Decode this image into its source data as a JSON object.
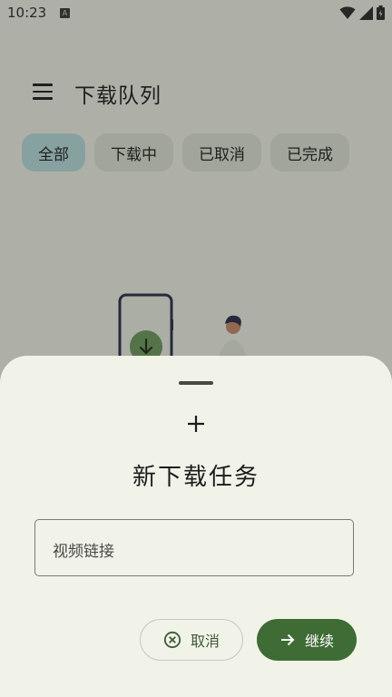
{
  "status_bar": {
    "time": "10:23",
    "notification_icon": "a-icon",
    "icons": [
      "wifi-icon",
      "signal-icon",
      "battery-icon"
    ]
  },
  "app_bar": {
    "menu_icon": "menu-icon",
    "title": "下载队列"
  },
  "filters": {
    "items": [
      {
        "label": "全部",
        "selected": true
      },
      {
        "label": "下载中",
        "selected": false
      },
      {
        "label": "已取消",
        "selected": false
      },
      {
        "label": "已完成",
        "selected": false
      }
    ]
  },
  "sheet": {
    "icon": "plus-icon",
    "title": "新下载任务",
    "url_field": {
      "placeholder": "视频链接",
      "value": ""
    },
    "cancel_button": {
      "label": "取消",
      "icon": "cancel-circle-icon"
    },
    "continue_button": {
      "label": "继续",
      "icon": "arrow-right-icon"
    }
  },
  "colors": {
    "background": "#f2f4ea",
    "chip_selected": "#b9dde0",
    "chip": "#dfe3d6",
    "primary": "#3f6b34",
    "scrim": "rgba(32,34,28,0.32)"
  }
}
